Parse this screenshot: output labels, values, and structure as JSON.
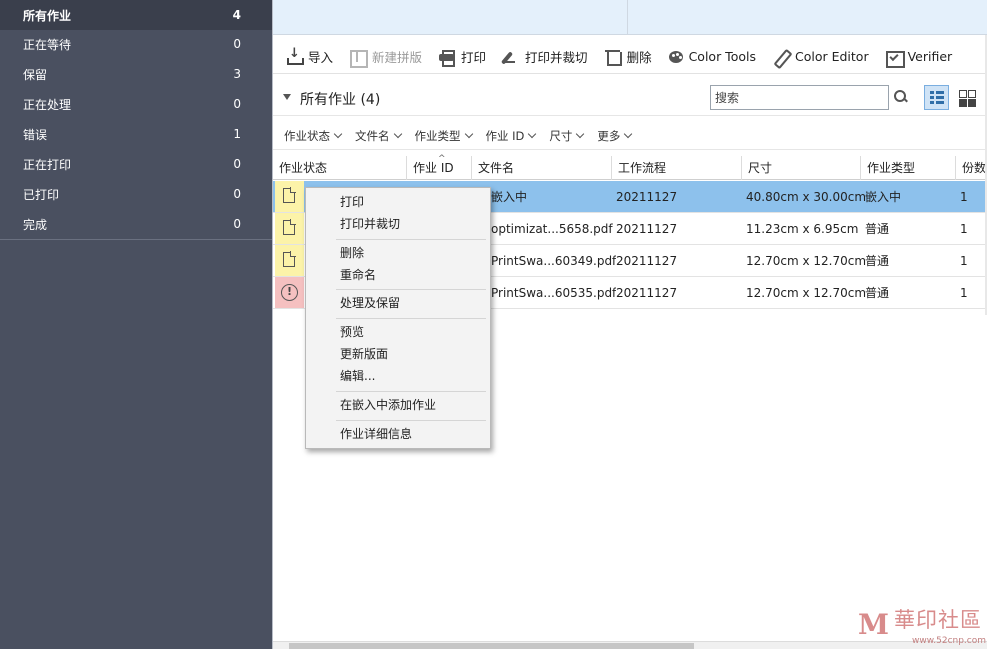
{
  "sidebar": {
    "items": [
      {
        "label": "所有作业",
        "count": "4"
      },
      {
        "label": "正在等待",
        "count": "0"
      },
      {
        "label": "保留",
        "count": "3"
      },
      {
        "label": "正在处理",
        "count": "0"
      },
      {
        "label": "错误",
        "count": "1"
      },
      {
        "label": "正在打印",
        "count": "0"
      },
      {
        "label": "已打印",
        "count": "0"
      },
      {
        "label": "完成",
        "count": "0"
      }
    ]
  },
  "toolbar": {
    "import": "导入",
    "new_layout": "新建拼版",
    "print": "打印",
    "print_cut": "打印并裁切",
    "delete": "删除",
    "color_tools": "Color Tools",
    "color_editor": "Color Editor",
    "verifier": "Verifier"
  },
  "section": {
    "title": "所有作业 (4)",
    "search_placeholder": "搜索"
  },
  "filters": [
    "作业状态",
    "文件名",
    "作业类型",
    "作业 ID",
    "尺寸",
    "更多"
  ],
  "table": {
    "columns": [
      "作业状态",
      "作业 ID",
      "文件名",
      "工作流程",
      "尺寸",
      "作业类型",
      "份数"
    ],
    "rows": [
      {
        "status": "doc",
        "filename": "嵌入中",
        "workflow": "20211127",
        "size": "40.80cm x 30.00cm",
        "type": "嵌入中",
        "copies": "1"
      },
      {
        "status": "doc",
        "filename": "optimizat...5658.pdf",
        "workflow": "20211127",
        "size": "11.23cm x 6.95cm",
        "type": "普通",
        "copies": "1"
      },
      {
        "status": "doc",
        "filename": "PrintSwa...60349.pdf",
        "workflow": "20211127",
        "size": "12.70cm x 12.70cm",
        "type": "普通",
        "copies": "1"
      },
      {
        "status": "error",
        "filename": "PrintSwa...60535.pdf",
        "workflow": "20211127",
        "size": "12.70cm x 12.70cm",
        "type": "普通",
        "copies": "1"
      }
    ]
  },
  "context_menu": {
    "print": "打印",
    "print_cut": "打印并裁切",
    "delete": "删除",
    "rename": "重命名",
    "process_hold": "处理及保留",
    "preview": "预览",
    "update_layout": "更新版面",
    "edit": "编辑...",
    "add_to_nesting": "在嵌入中添加作业",
    "job_details": "作业详细信息"
  },
  "watermark": {
    "text": "華印社區",
    "url": "www.52cnp.com"
  }
}
